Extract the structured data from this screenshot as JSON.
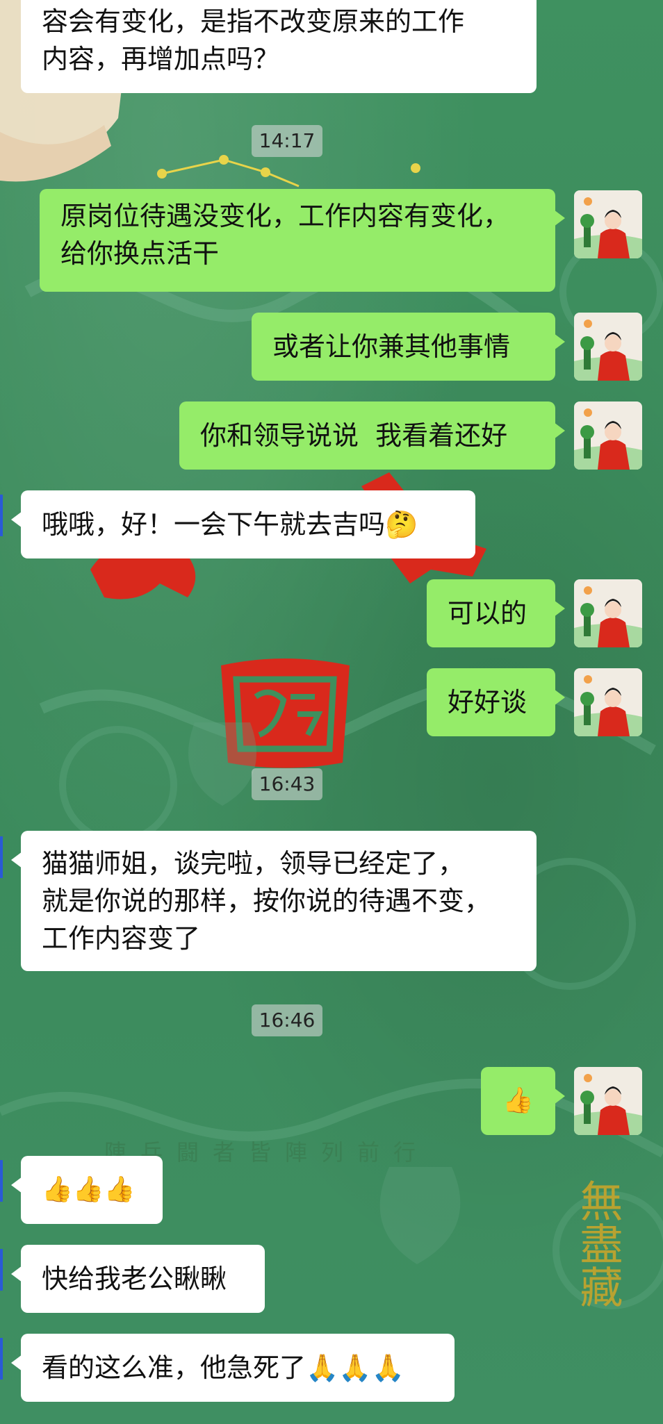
{
  "timestamps": [
    "14:17",
    "16:43",
    "16:46"
  ],
  "messages": [
    {
      "side": "left",
      "lines": [
        "容会有变化，是指不改变原来的工作",
        "内容，再增加点吗？"
      ]
    },
    {
      "side": "right",
      "lines": [
        "原岗位待遇没变化，工作内容有变化，",
        "给你换点活干"
      ]
    },
    {
      "side": "right",
      "lines": [
        "或者让你兼其他事情"
      ]
    },
    {
      "side": "right",
      "lines": [
        "你和领导说说  我看着还好"
      ]
    },
    {
      "side": "left",
      "lines": [
        "哦哦，好！一会下午就去吉吗🤔"
      ]
    },
    {
      "side": "right",
      "lines": [
        "可以的"
      ]
    },
    {
      "side": "right",
      "lines": [
        "好好谈"
      ]
    },
    {
      "side": "left",
      "lines": [
        "猫猫师姐，谈完啦，领导已经定了，",
        "就是你说的那样，按你说的待遇不变，",
        "工作内容变了"
      ]
    },
    {
      "side": "right",
      "lines": [
        "👍"
      ]
    },
    {
      "side": "left",
      "lines": [
        "👍👍👍"
      ]
    },
    {
      "side": "left",
      "lines": [
        "快给我老公瞅瞅"
      ]
    },
    {
      "side": "left",
      "lines": [
        "看的这么准，他急死了🙏🙏🙏"
      ]
    }
  ],
  "background": {
    "large_seal_text": "圖",
    "calligraphy": "無盡藏",
    "motto": "陳兵闘者皆陣列前行"
  },
  "colors": {
    "background": "#3f8f5d",
    "self_bubble": "#95ec69",
    "other_bubble": "#ffffff",
    "seal_red": "#d9291c"
  },
  "icons": {
    "avatar": "avatar-woman-red-hanfu"
  }
}
